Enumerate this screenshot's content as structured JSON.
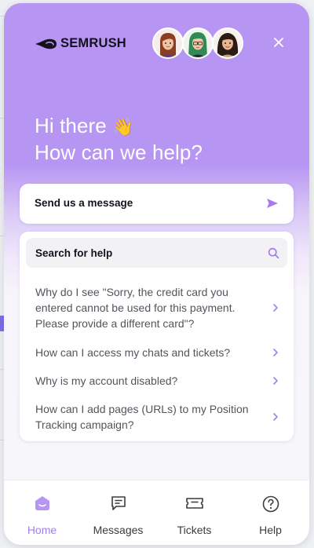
{
  "brand": {
    "logo_text": "SEMRUSH"
  },
  "header": {
    "greeting_line1": "Hi there",
    "wave_emoji": "👋",
    "greeting_line2": "How can we help?",
    "avatars": [
      "agent-avatar-1",
      "agent-avatar-2",
      "agent-avatar-3"
    ],
    "close_icon": "close-icon"
  },
  "message_card": {
    "label": "Send us a message",
    "icon": "send-icon"
  },
  "search": {
    "placeholder": "Search for help",
    "icon": "search-icon"
  },
  "faq": [
    {
      "text": "Why do I see \"Sorry, the credit card you entered cannot be used for this payment. Please provide a different card\"?"
    },
    {
      "text": "How can I access my chats and tickets?"
    },
    {
      "text": "Why is my account disabled?"
    },
    {
      "text": "How can I add pages (URLs) to my Position Tracking campaign?"
    }
  ],
  "nav": [
    {
      "label": "Home",
      "icon": "home-icon",
      "active": true
    },
    {
      "label": "Messages",
      "icon": "messages-icon",
      "active": false
    },
    {
      "label": "Tickets",
      "icon": "tickets-icon",
      "active": false
    },
    {
      "label": "Help",
      "icon": "help-icon",
      "active": false
    }
  ],
  "colors": {
    "header_purple": "#b795f3",
    "accent_purple": "#a47cf0",
    "text_dark": "#16121d",
    "text_muted": "#55535c"
  }
}
